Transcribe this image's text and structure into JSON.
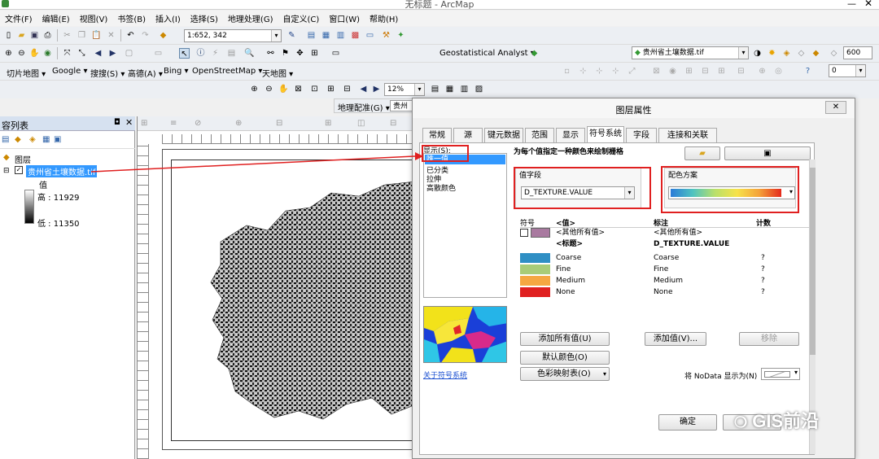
{
  "window": {
    "title": "无标题 - ArcMap"
  },
  "menu": [
    "文件(F)",
    "编辑(E)",
    "视图(V)",
    "书签(B)",
    "插入(I)",
    "选择(S)",
    "地理处理(G)",
    "自定义(C)",
    "窗口(W)",
    "帮助(H)"
  ],
  "toolbar": {
    "scale": "1:652, 342",
    "geostat": "Geostatistical Analyst ▾",
    "layer_combo": "贵州省土壤数据.tif",
    "value_600": "600",
    "value_0": "0",
    "slice_map": "切片地图 ▾",
    "google": "Google ▾",
    "search": "搜搜(S) ▾",
    "gaode": "高德(A) ▾",
    "bing": "Bing ▾",
    "osm": "OpenStreetMap ▾",
    "tianditu": "天地图 ▾",
    "zoom_pct": "12%",
    "georef": "地理配准(G) ▾",
    "georef_layer": "贵州"
  },
  "toc": {
    "title": "容列表",
    "layers_label": "图层",
    "layer_name": "贵州省土壤数据.tif",
    "value_label": "值",
    "high": "高 : 11929",
    "low": "低 : 11350"
  },
  "dialog": {
    "title": "图层属性",
    "tabs": [
      "常规",
      "源",
      "键元数据",
      "范围",
      "显示",
      "符号系统",
      "字段",
      "连接和关联"
    ],
    "show_label": "显示(S):",
    "renderers": [
      "唯一值",
      "已分类",
      "拉伸",
      "高散颜色"
    ],
    "header": "为每个值指定一种颜色来绘制栅格",
    "value_field_label": "值字段",
    "value_field": "D_TEXTURE.VALUE",
    "color_scheme_label": "配色方案",
    "columns": [
      "符号",
      "<值>",
      "标注",
      "计数"
    ],
    "rows": [
      {
        "value": "<其他所有值>",
        "label": "<其他所有值>",
        "count": "",
        "color": "#a97aa0",
        "bold": false
      },
      {
        "value": "<标题>",
        "label": "D_TEXTURE.VALUE",
        "count": "",
        "color": "",
        "bold": true
      },
      {
        "value": "Coarse",
        "label": "Coarse",
        "count": "?",
        "color": "#2f8fc4",
        "bold": false
      },
      {
        "value": "Fine",
        "label": "Fine",
        "count": "?",
        "color": "#a8cc78",
        "bold": false
      },
      {
        "value": "Medium",
        "label": "Medium",
        "count": "?",
        "color": "#f5a742",
        "bold": false
      },
      {
        "value": "None",
        "label": "None",
        "count": "?",
        "color": "#e02020",
        "bold": false
      }
    ],
    "add_all_values": "添加所有值(U)",
    "add_values": "添加值(V)...",
    "remove": "移除",
    "default_colors": "默认颜色(O)",
    "colormap": "色彩映射表(O)",
    "about_link": "关于符号系统",
    "nodata_label": "将 NoData 显示为(N)",
    "ok": "确定"
  },
  "watermark": "GIS前沿",
  "colors": {
    "accent_red": "#e02020",
    "selection_blue": "#3399ff"
  }
}
